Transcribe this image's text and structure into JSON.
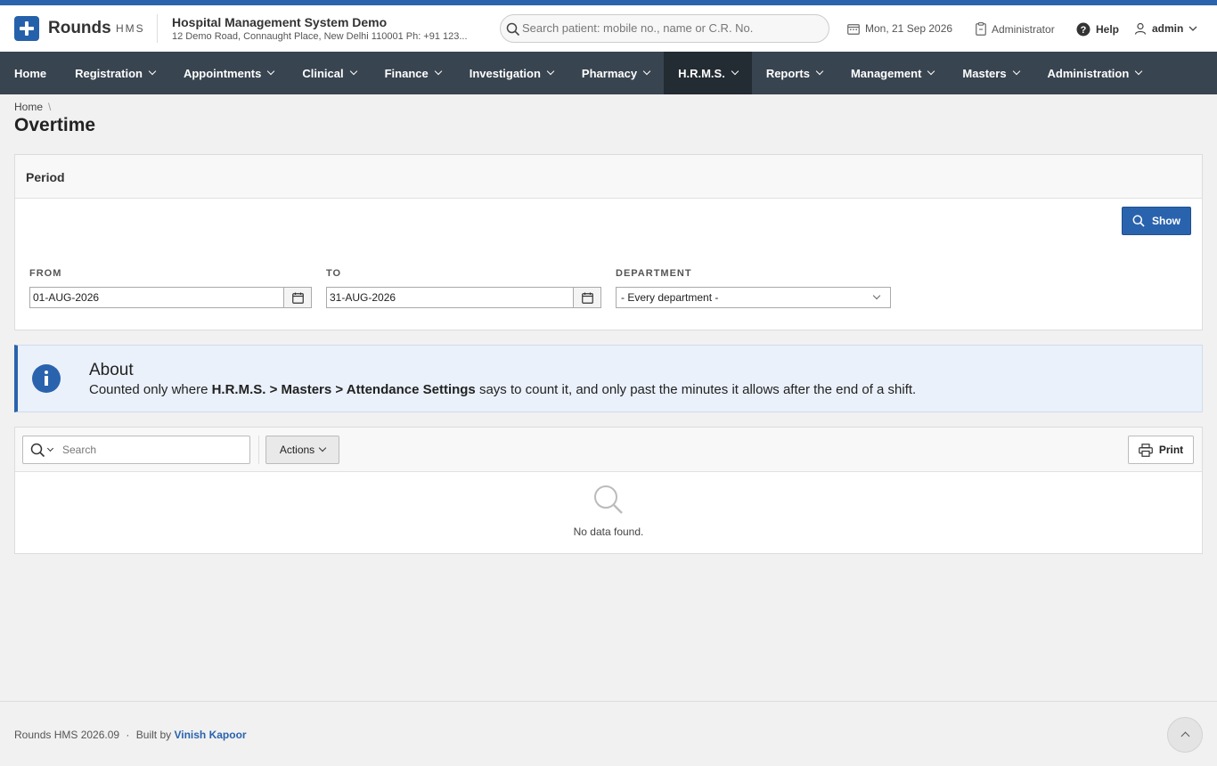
{
  "brand": {
    "name": "Rounds",
    "suffix": "HMS"
  },
  "hospital": {
    "name": "Hospital Management System Demo",
    "address": "12 Demo Road, Connaught Place, New Delhi 110001 Ph: +91 123..."
  },
  "header": {
    "search_placeholder": "Search patient: mobile no., name or C.R. No.",
    "date": "Mon, 21 Sep 2026",
    "role": "Administrator",
    "help": "Help",
    "user": "admin"
  },
  "nav": {
    "items": [
      "Home",
      "Registration",
      "Appointments",
      "Clinical",
      "Finance",
      "Investigation",
      "Pharmacy",
      "H.R.M.S.",
      "Reports",
      "Management",
      "Masters",
      "Administration"
    ],
    "active": "H.R.M.S."
  },
  "breadcrumb": {
    "home": "Home",
    "separator": "\\"
  },
  "page": {
    "title": "Overtime"
  },
  "period": {
    "heading": "Period",
    "show_label": "Show",
    "from_label": "FROM",
    "from_value": "01-AUG-2026",
    "to_label": "TO",
    "to_value": "31-AUG-2026",
    "department_label": "DEPARTMENT",
    "department_value": "- Every department -"
  },
  "about": {
    "title": "About",
    "text_before": "Counted only where ",
    "text_bold": "H.R.M.S. > Masters > Attendance Settings",
    "text_after": " says to count it, and only past the minutes it allows after the end of a shift."
  },
  "report": {
    "search_placeholder": "Search",
    "actions_label": "Actions",
    "print_label": "Print",
    "empty_text": "No data found."
  },
  "footer": {
    "version": "Rounds HMS 2026.09",
    "built_by": "Built by",
    "author": "Vinish Kapoor"
  },
  "colors": {
    "accent": "#2a63ad",
    "nav_bg": "#38444f",
    "nav_active": "#232b33"
  }
}
